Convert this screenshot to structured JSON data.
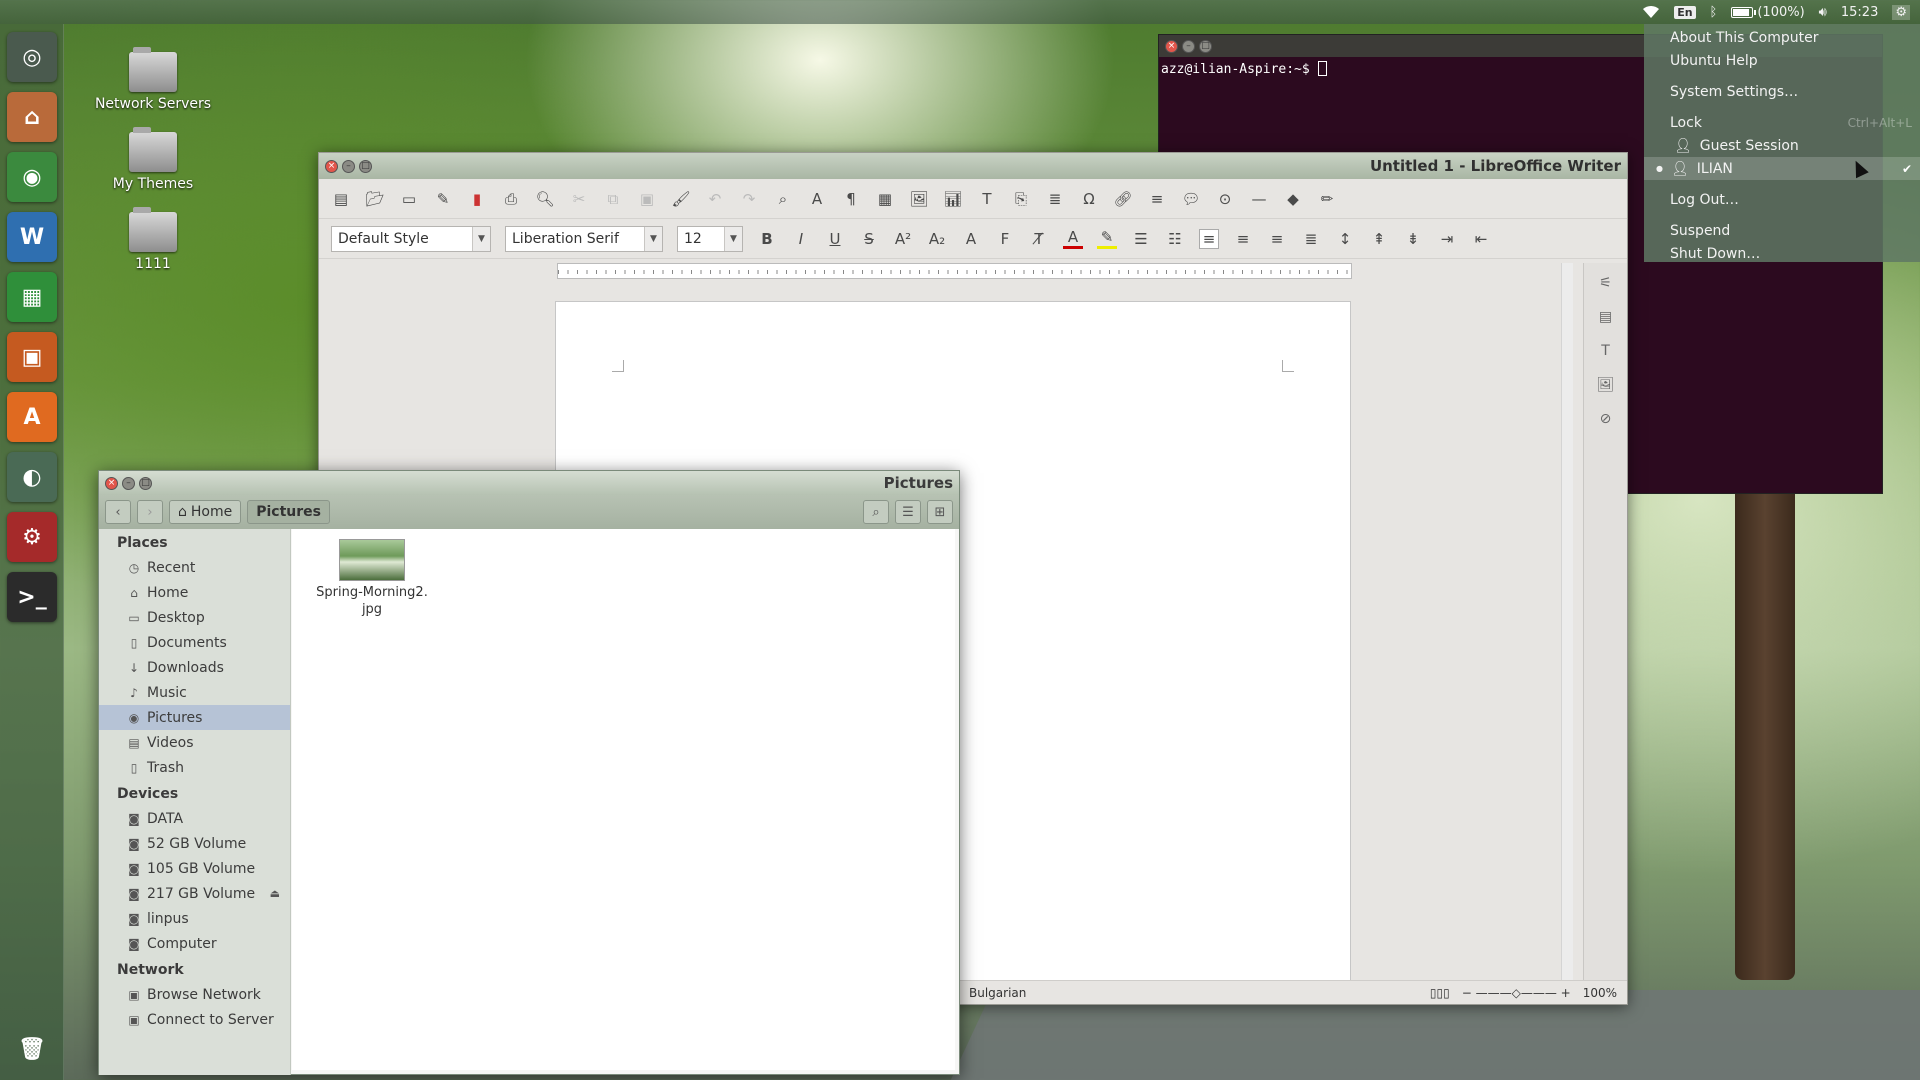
{
  "top_panel": {
    "keyboard_layout": "En",
    "battery": "(100%)",
    "battery_level": 1.0,
    "clock": "15:23"
  },
  "launcher": {
    "items": [
      {
        "name": "dash",
        "glyph": "◎",
        "color": "#4a5a4e"
      },
      {
        "name": "files",
        "glyph": "⌂",
        "color": "#b96a3a"
      },
      {
        "name": "chrome",
        "glyph": "◉",
        "color": "#3b8a3e"
      },
      {
        "name": "writer",
        "glyph": "W",
        "color": "#2f6fb0"
      },
      {
        "name": "calc",
        "glyph": "▦",
        "color": "#2f8f3a"
      },
      {
        "name": "impress",
        "glyph": "▣",
        "color": "#c55a20"
      },
      {
        "name": "software-center",
        "glyph": "A",
        "color": "#e06a20"
      },
      {
        "name": "disk-utility",
        "glyph": "◐",
        "color": "#4a6a55"
      },
      {
        "name": "system-settings",
        "glyph": "⚙",
        "color": "#a52a2a"
      },
      {
        "name": "terminal",
        "glyph": ">_",
        "color": "#2b2b2b"
      }
    ],
    "trash_glyph": "🗑"
  },
  "desktop": {
    "icons": [
      {
        "label": "Network Servers"
      },
      {
        "label": "My Themes"
      },
      {
        "label": "1111"
      }
    ]
  },
  "terminal": {
    "prompt": "azz@ilian-Aspire:~$ "
  },
  "writer": {
    "title": "Untitled 1 - LibreOffice Writer",
    "paragraph_style": "Default Style",
    "font_name": "Liberation Serif",
    "font_size": "12",
    "status_language": "Bulgarian",
    "zoom": "100%"
  },
  "files": {
    "title": "Pictures",
    "breadcrumb": {
      "home": "Home",
      "current": "Pictures"
    },
    "places_header": "Places",
    "places": [
      "Recent",
      "Home",
      "Desktop",
      "Documents",
      "Downloads",
      "Music",
      "Pictures",
      "Videos",
      "Trash"
    ],
    "devices_header": "Devices",
    "devices": [
      "DATA",
      "52 GB Volume",
      "105 GB Volume",
      "217 GB Volume",
      "linpus",
      "Computer"
    ],
    "network_header": "Network",
    "network": [
      "Browse Network",
      "Connect to Server"
    ],
    "file_name_line1": "Spring-Morning2.",
    "file_name_line2": "jpg"
  },
  "user_menu": {
    "about": "About This Computer",
    "help": "Ubuntu Help",
    "settings": "System Settings…",
    "lock": "Lock",
    "lock_shortcut": "Ctrl+Alt+L",
    "guest": "Guest Session",
    "user": "ILIAN",
    "logout": "Log Out…",
    "suspend": "Suspend",
    "shutdown": "Shut Down…"
  }
}
